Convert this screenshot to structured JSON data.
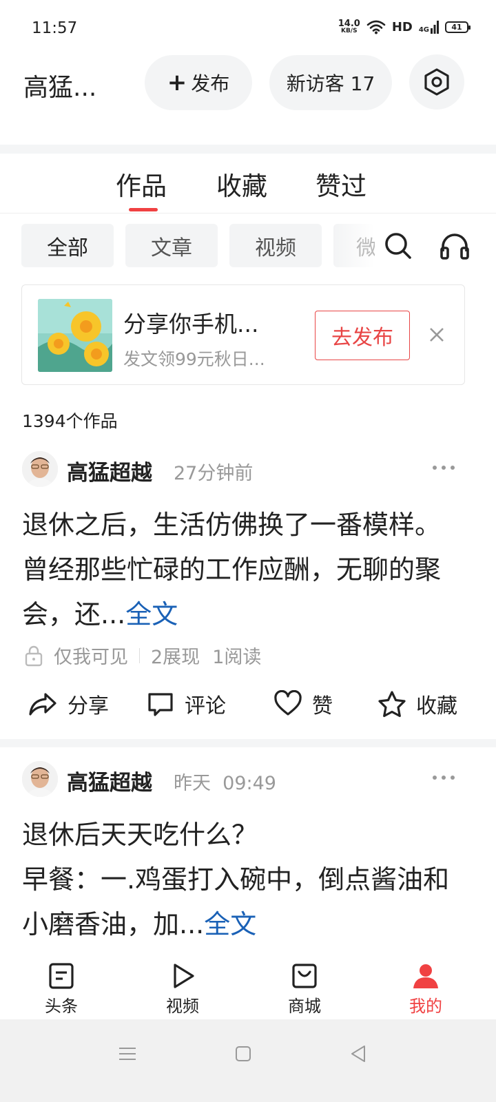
{
  "status_bar": {
    "time": "11:57",
    "net_speed": "14.0",
    "net_unit": "KB/S",
    "hd": "HD",
    "signal": "4G",
    "battery": "41"
  },
  "header": {
    "profile_name": "高猛...",
    "publish_label": "发布",
    "visitors_label": "新访客 17"
  },
  "tabs": [
    {
      "label": "作品",
      "active": true
    },
    {
      "label": "收藏",
      "active": false
    },
    {
      "label": "赞过",
      "active": false
    }
  ],
  "filters": [
    {
      "label": "全部",
      "active": true
    },
    {
      "label": "文章",
      "active": false
    },
    {
      "label": "视频",
      "active": false
    },
    {
      "label": "微",
      "active": false
    }
  ],
  "promo": {
    "title": "分享你手机...",
    "subtitle": "发文领99元秋日...",
    "button_label": "去发布"
  },
  "works_count": "1394个作品",
  "posts": [
    {
      "author": "高猛超越",
      "time": "27分钟前",
      "body": "退休之后，生活仿佛换了一番模样。曾经那些忙碌的工作应酬，无聊的聚会，还...",
      "full_link": "全文",
      "visibility": "仅我可见",
      "impressions": "2展现",
      "reads": "1阅读"
    },
    {
      "author": "高猛超越",
      "time": "昨天  09:49",
      "body_line1": "退休后天天吃什么？",
      "body_line2": "早餐：一.鸡蛋打入碗中，倒点酱油和小磨香油，加...",
      "full_link": "全文"
    }
  ],
  "actions": {
    "share": "分享",
    "comment": "评论",
    "like": "赞",
    "collect": "收藏"
  },
  "bottom_nav": [
    {
      "label": "头条",
      "active": false
    },
    {
      "label": "视频",
      "active": false
    },
    {
      "label": "商城",
      "active": false
    },
    {
      "label": "我的",
      "active": true
    }
  ],
  "colors": {
    "accent": "#f04142",
    "link": "#1a61b6",
    "chip_bg": "#f3f4f5"
  }
}
